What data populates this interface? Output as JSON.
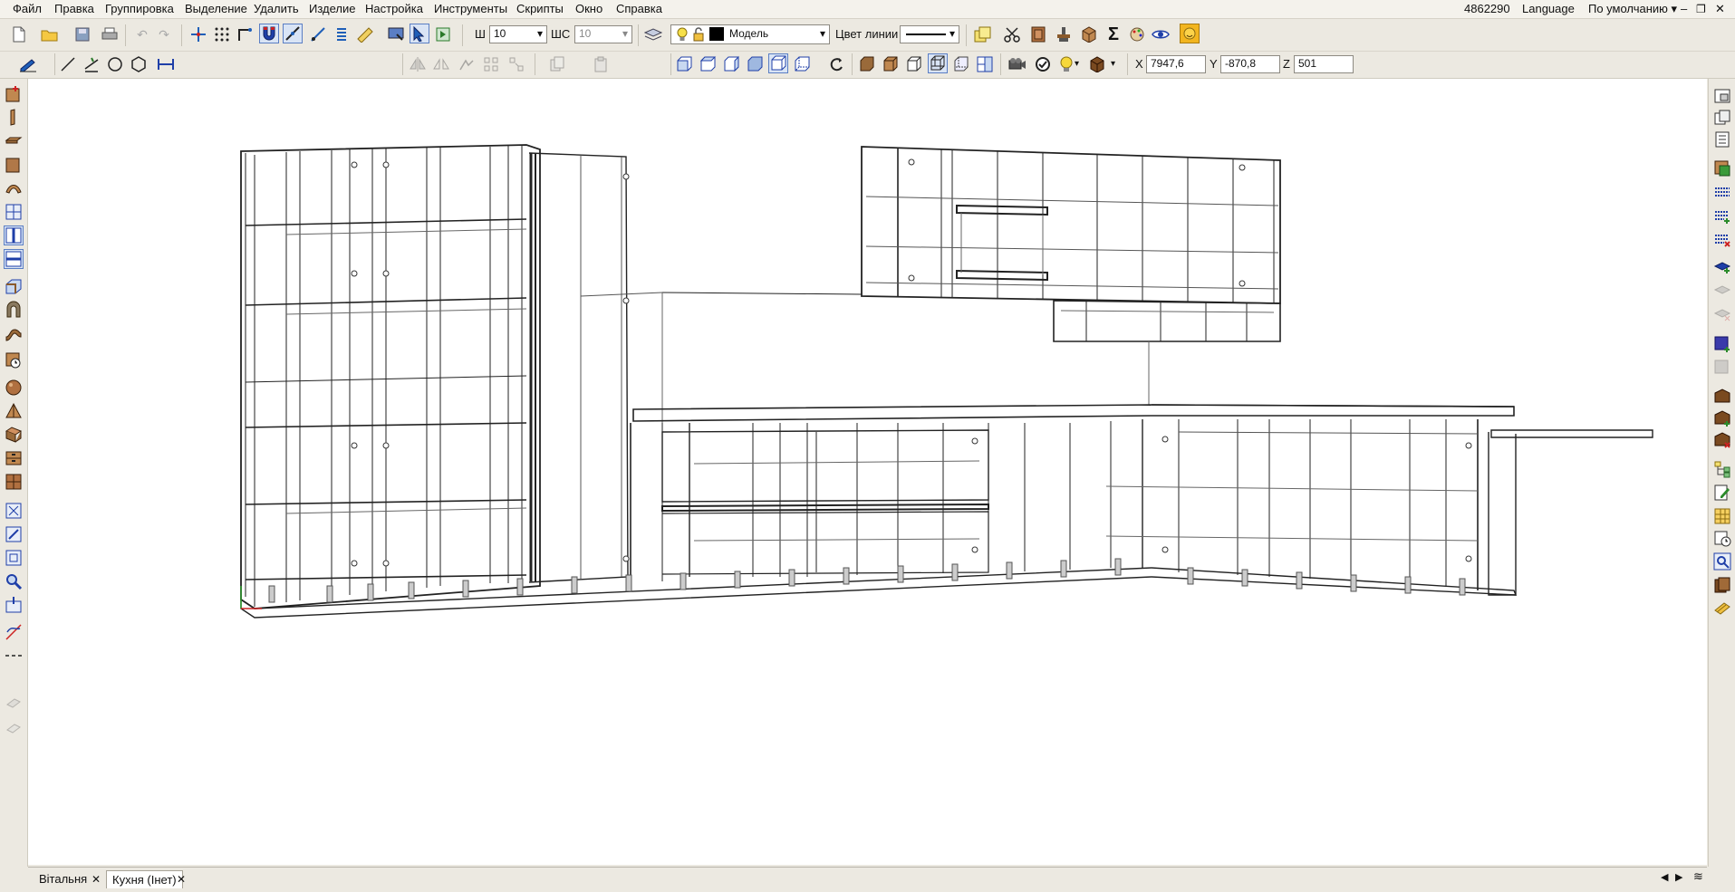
{
  "menu": {
    "items": [
      "Файл",
      "Правка",
      "Группировка",
      "Выделение",
      "Удалить",
      "Изделие",
      "Настройка",
      "Инструменты",
      "Скрипты",
      "Окно",
      "Справка"
    ],
    "id_number": "4862290",
    "language": "Language",
    "layout_preset": "По умолчанию"
  },
  "toolbar": {
    "w_label": "Ш",
    "w_value": "10",
    "shs_label": "ШС",
    "shs_value": "10",
    "layer_name": "Модель",
    "line_color_label": "Цвет линии",
    "layer_color": "#000000"
  },
  "coords": {
    "x_label": "X",
    "x_value": "7947,6",
    "y_label": "Y",
    "y_value": "-870,8",
    "z_label": "Z",
    "z_value": "501"
  },
  "tabs": [
    {
      "label": "Вітальня",
      "active": false
    },
    {
      "label": "Кухня (Інет)",
      "active": true
    }
  ],
  "colors": {
    "accent": "#5a7ec4",
    "tool_blue": "#1f5fb8",
    "tool_brown": "#8a5a2b",
    "wire": "#222222"
  }
}
